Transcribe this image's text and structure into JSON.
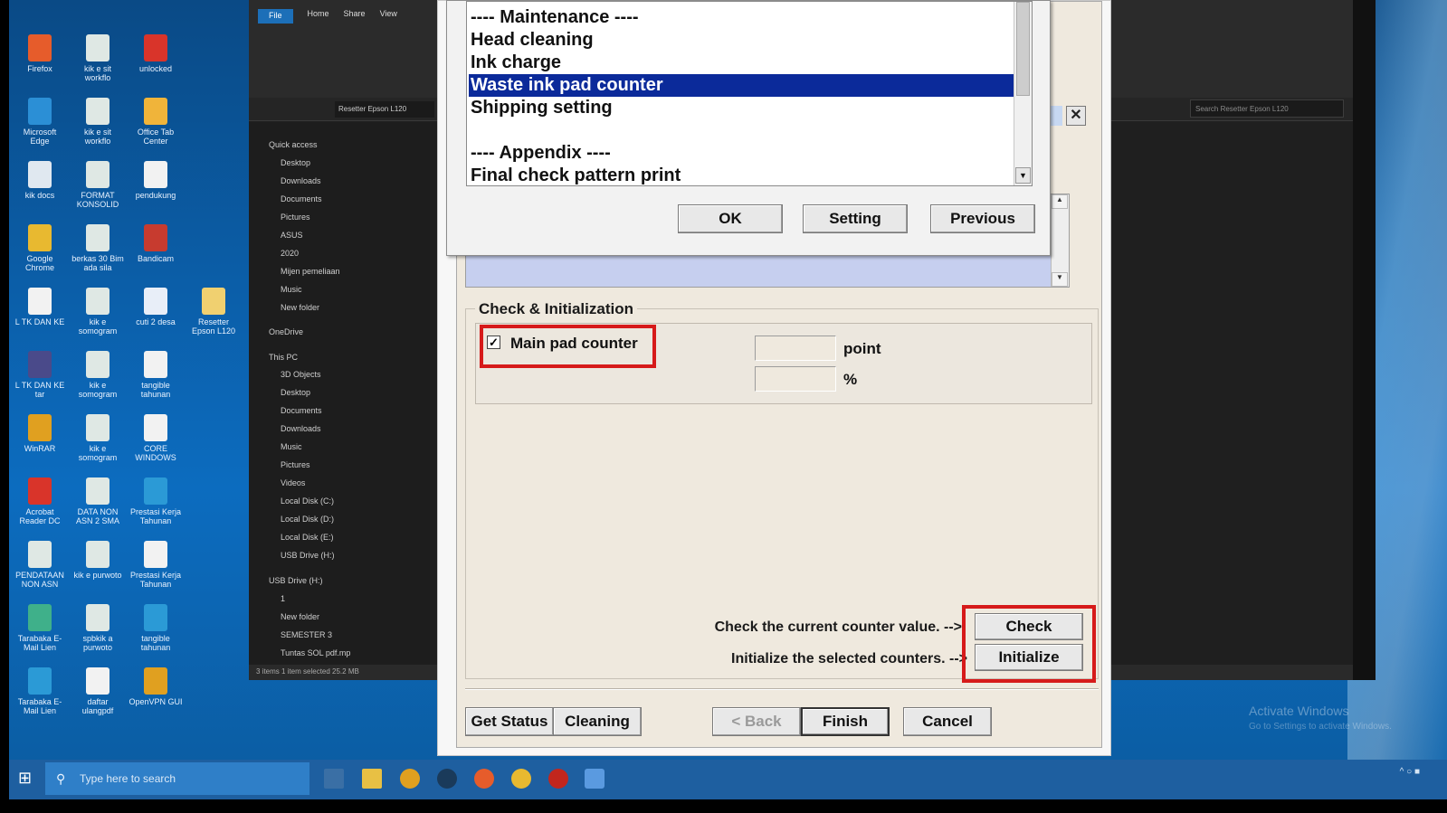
{
  "desktop": {
    "icons": [
      {
        "label": "Firefox",
        "color": "#e65c2b"
      },
      {
        "label": "kik e sit workflo",
        "color": "#dfe8e4"
      },
      {
        "label": "unlocked",
        "color": "#d9342a"
      },
      {
        "label": "Microsoft Edge",
        "color": "#2b8fd6"
      },
      {
        "label": "kik e sit workflo",
        "color": "#dfe8e4"
      },
      {
        "label": "Office Tab Center",
        "color": "#f0b43a"
      },
      {
        "label": "kik docs",
        "color": "#e0e8f0"
      },
      {
        "label": "FORMAT KONSOLID",
        "color": "#dfe8e4"
      },
      {
        "label": "pendukung",
        "color": "#f2f2f2"
      },
      {
        "label": "Google Chrome",
        "color": "#e8b930"
      },
      {
        "label": "berkas 30 Bim ada sila",
        "color": "#dfe8e4"
      },
      {
        "label": "Bandicam",
        "color": "#c73b2f"
      },
      {
        "label": "L TK DAN KE",
        "color": "#f2f2f2"
      },
      {
        "label": "kik e somogram",
        "color": "#dfe8e4"
      },
      {
        "label": "cuti 2 desa",
        "color": "#e8eef8"
      },
      {
        "label": "Resetter Epson L120",
        "color": "#f0d070"
      },
      {
        "label": "L TK DAN KE tar",
        "color": "#4a4a8a"
      },
      {
        "label": "kik e somogram",
        "color": "#dfe8e4"
      },
      {
        "label": "tangible tahunan",
        "color": "#f2f2f2"
      },
      {
        "label": "WinRAR",
        "color": "#e0a020"
      },
      {
        "label": "kik e somogram",
        "color": "#dfe8e4"
      },
      {
        "label": "CORE WINDOWS",
        "color": "#f2f2f2"
      },
      {
        "label": "Acrobat Reader DC",
        "color": "#d9342a"
      },
      {
        "label": "DATA NON ASN 2 SMA",
        "color": "#dfe8e4"
      },
      {
        "label": "Prestasi Kerja Tahunan",
        "color": "#2b9ad6"
      },
      {
        "label": "PENDATAAN NON ASN",
        "color": "#dfe8e4"
      },
      {
        "label": "kik e purwoto",
        "color": "#dfe8e4"
      },
      {
        "label": "Prestasi Kerja Tahunan",
        "color": "#f2f2f2"
      },
      {
        "label": "Tarabaka E-Mail Lien",
        "color": "#3fb08a"
      },
      {
        "label": "spbkik a purwoto",
        "color": "#dfe8e4"
      },
      {
        "label": "tangible tahunan",
        "color": "#2b9ad6"
      },
      {
        "label": "Tarabaka E-Mail Lien",
        "color": "#2b9ad6"
      },
      {
        "label": "daftar ulangpdf",
        "color": "#f2f2f2"
      },
      {
        "label": "OpenVPN GUI",
        "color": "#e0a020"
      }
    ]
  },
  "explorer": {
    "tabs": [
      "File",
      "Home",
      "Share",
      "View"
    ],
    "address": "Resetter Epson L120",
    "search_placeholder": "Search Resetter Epson L120",
    "nav_items": [
      "Quick access",
      "Desktop",
      "Downloads",
      "Documents",
      "Pictures",
      "ASUS",
      "2020",
      "Mijen pemeliaan",
      "Music",
      "New folder",
      "OneDrive",
      "This PC",
      "3D Objects",
      "Desktop",
      "Documents",
      "Downloads",
      "Music",
      "Pictures",
      "Videos",
      "Local Disk (C:)",
      "Local Disk (D:)",
      "Local Disk (E:)",
      "USB Drive (H:)",
      "USB Drive (H:)",
      "1",
      "New folder",
      "SEMESTER 3",
      "Tuntas SOL pdf.mp"
    ],
    "status": "3 items   1 item selected  25.2 MB"
  },
  "taskbar": {
    "search_placeholder": "Type here to search",
    "activate_title": "Activate Windows",
    "activate_sub": "Go to Settings to activate Windows."
  },
  "maintenance_dialog": {
    "list_items": [
      {
        "label": "---- Maintenance ----",
        "selected": false
      },
      {
        "label": "Head cleaning",
        "selected": false
      },
      {
        "label": "Ink charge",
        "selected": false
      },
      {
        "label": "Waste ink pad counter",
        "selected": true
      },
      {
        "label": "Shipping setting",
        "selected": false
      },
      {
        "label": "",
        "selected": false
      },
      {
        "label": "---- Appendix ----",
        "selected": false
      },
      {
        "label": "Final check pattern print",
        "selected": false
      }
    ],
    "ok_label": "OK",
    "setting_label": "Setting",
    "previous_label": "Previous"
  },
  "counter_dialog": {
    "close_glyph": "✕",
    "group_title": "Check & Initialization",
    "main_pad_label": "Main pad counter",
    "main_pad_checked": true,
    "point_value": "",
    "point_unit": "point",
    "percent_value": "",
    "percent_unit": "%",
    "check_hint": "Check the current counter value. -->",
    "init_hint": "Initialize the selected counters. -->",
    "check_label": "Check",
    "initialize_label": "Initialize",
    "get_status_label": "Get Status",
    "cleaning_label": "Cleaning",
    "back_label": "< Back",
    "finish_label": "Finish",
    "cancel_label": "Cancel"
  },
  "colors": {
    "selection": "#0b2a9a",
    "highlight_red": "#d61a1a",
    "dialog_bg": "#efe9de",
    "log_bg": "#c6cfef"
  }
}
